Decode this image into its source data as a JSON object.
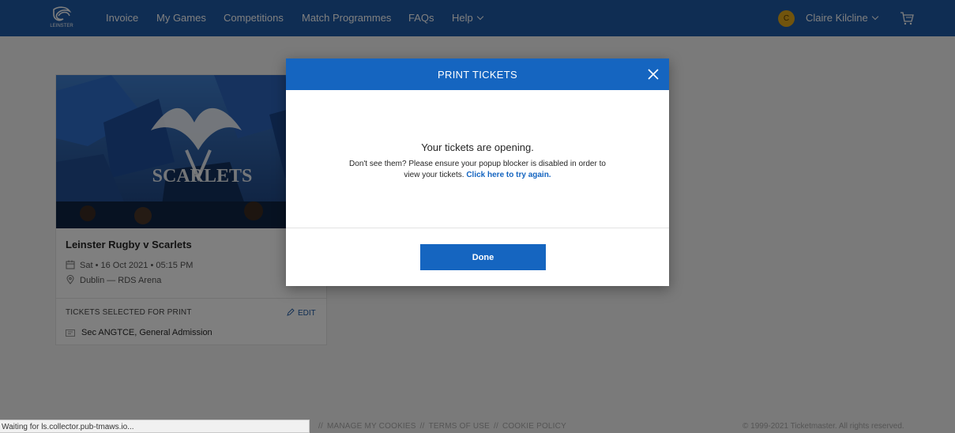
{
  "nav": {
    "items": [
      "Invoice",
      "My Games",
      "Competitions",
      "Match Programmes",
      "FAQs",
      "Help"
    ],
    "user_initial": "C",
    "user_name": "Claire Kilcline",
    "logo_text": "LEINSTER"
  },
  "event": {
    "banner_text": "SCARLETS",
    "title": "Leinster Rugby v Scarlets",
    "date": "Sat • 16 Oct 2021 • 05:15 PM",
    "venue": "Dublin — RDS Arena",
    "selected_label": "TICKETS SELECTED FOR PRINT",
    "edit_label": "EDIT",
    "ticket": "Sec ANGTCE, General Admission"
  },
  "modal": {
    "title": "PRINT TICKETS",
    "heading": "Your tickets are opening.",
    "body": "Don't see them? Please ensure your popup blocker is disabled in order to view your tickets.",
    "link": "Click here to try again.",
    "done": "Done"
  },
  "footer": {
    "links": [
      "MANAGE MY COOKIES",
      "TERMS OF USE",
      "COOKIE POLICY"
    ],
    "copyright": "© 1999-2021 Ticketmaster. All rights reserved."
  },
  "status": "Waiting for ls.collector.pub-tmaws.io...",
  "colors": {
    "nav": "#1f5aa6",
    "modal_header": "#1565c0",
    "accent": "#1565c0",
    "avatar": "#e3a81b"
  }
}
